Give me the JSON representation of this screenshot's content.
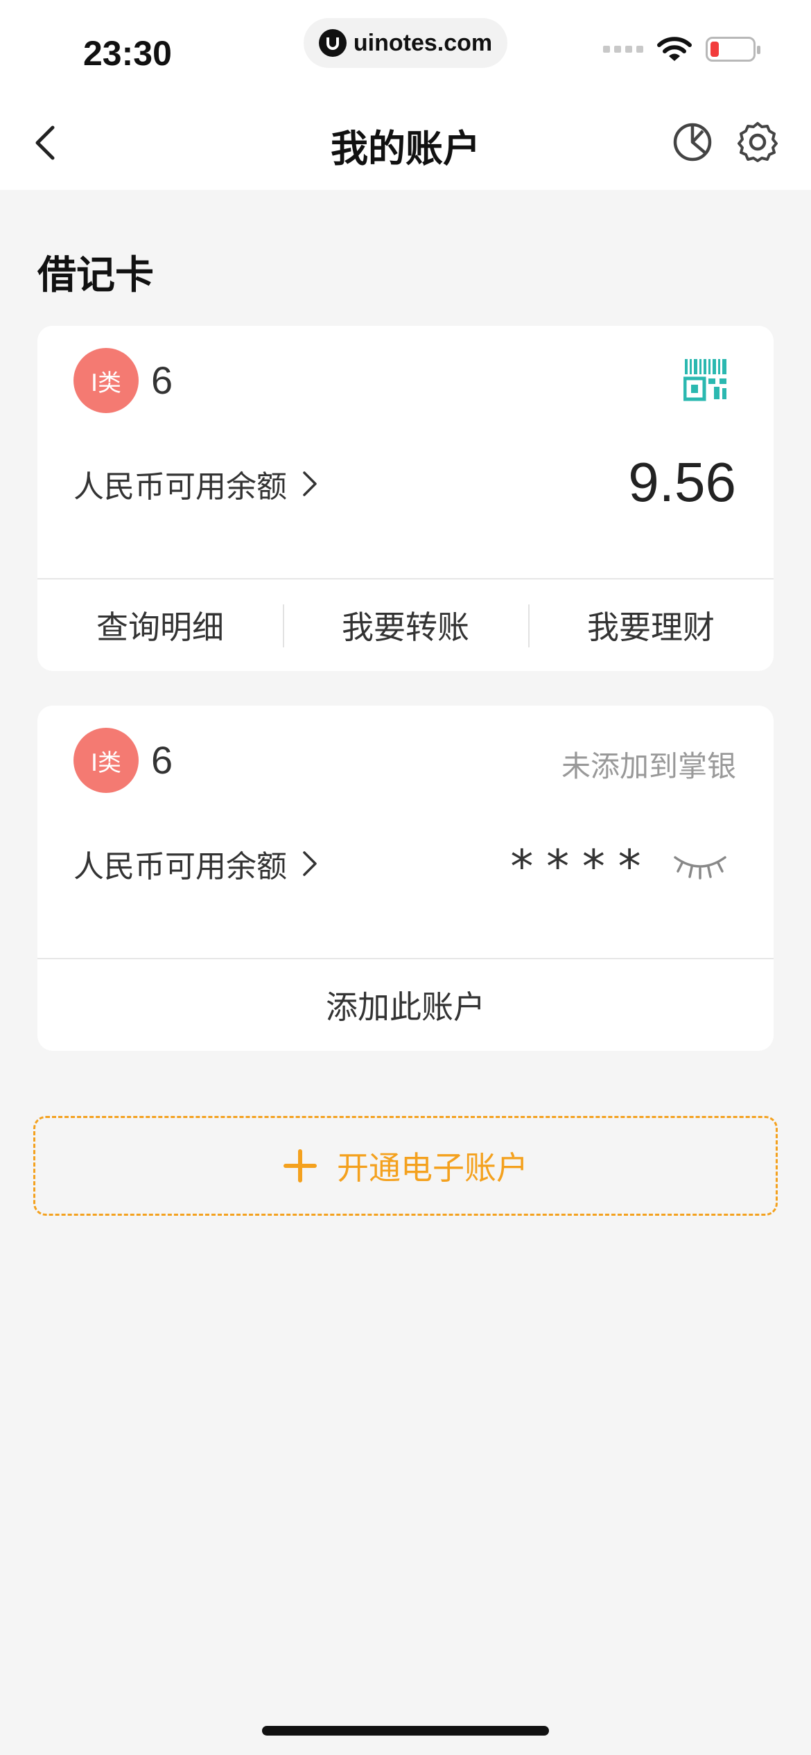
{
  "status_bar": {
    "time": "23:30",
    "url": "uinotes.com"
  },
  "nav": {
    "title": "我的账户"
  },
  "section": {
    "title": "借记卡"
  },
  "cards": [
    {
      "badge": "I类",
      "account_number": "6",
      "balance_label": "人民币可用余额",
      "balance_value": "9.56",
      "actions": [
        "查询明细",
        "我要转账",
        "我要理财"
      ]
    },
    {
      "badge": "I类",
      "account_number": "6",
      "status": "未添加到掌银",
      "balance_label": "人民币可用余额",
      "balance_masked": "****",
      "action": "添加此账户"
    }
  ],
  "open_account": {
    "label": "开通电子账户"
  },
  "colors": {
    "badge": "#f47a72",
    "accent": "#f4a11e",
    "qr": "#2bb8b0",
    "battery_low": "#f23b3b"
  }
}
